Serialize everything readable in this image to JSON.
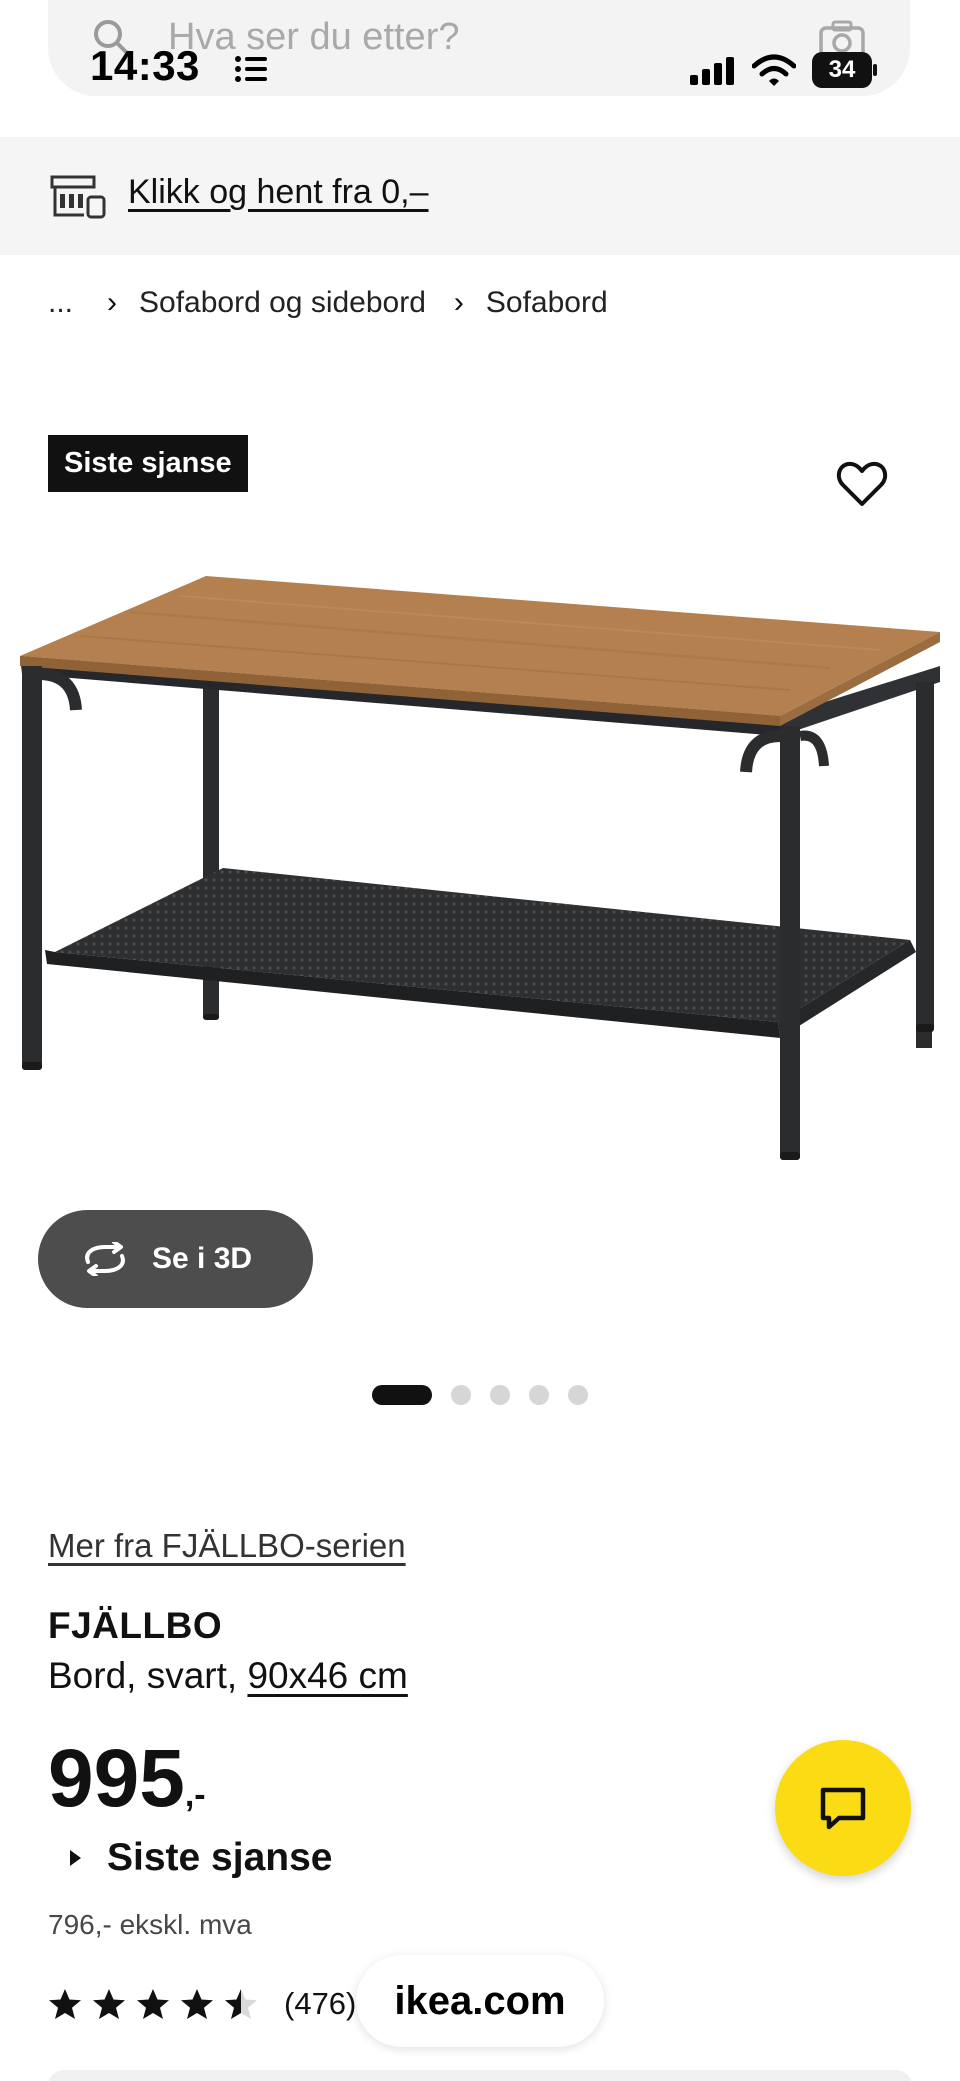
{
  "search": {
    "placeholder": "Hva ser du etter?"
  },
  "status_bar": {
    "time": "14:33",
    "battery": "34"
  },
  "banner": {
    "link_text": "Klikk og hent fra 0,–"
  },
  "breadcrumb": {
    "ellipsis": "...",
    "items": [
      "Sofabord og sidebord",
      "Sofabord"
    ],
    "separator": "›"
  },
  "gallery": {
    "badge": "Siste sjanse",
    "view_3d_label": "Se i 3D",
    "slide_count": 5,
    "active_slide": 1
  },
  "product": {
    "series_link": "Mer fra FJÄLLBO-serien",
    "name": "FJÄLLBO",
    "description": "Bord, svart, ",
    "size_link": "90x46 cm",
    "price": "995",
    "price_suffix": ",-",
    "last_chance_label": "Siste sjanse",
    "ex_vat": "796,- ekskl. mva",
    "rating": 4.5,
    "review_count": "(476)"
  },
  "browser": {
    "domain": "ikea.com"
  },
  "colors": {
    "badge_bg": "#111111",
    "chat_button": "#fadb14",
    "view_3d_bg": "#4d4d4d",
    "wood": "#b88557"
  },
  "icons": [
    "search-icon",
    "camera-icon",
    "store-icon",
    "heart-icon",
    "rotate-3d-icon",
    "chat-icon",
    "star-icon"
  ]
}
